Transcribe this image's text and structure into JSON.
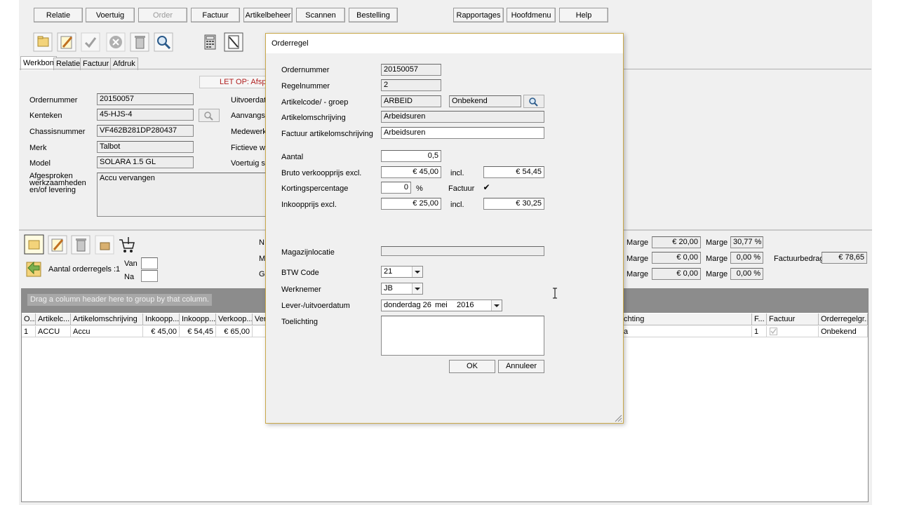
{
  "menu": {
    "relatie": "Relatie",
    "voertuig": "Voertuig",
    "order": "Order",
    "factuur": "Factuur",
    "artikelbeheer": "Artikelbeheer",
    "scannen": "Scannen",
    "bestelling": "Bestelling",
    "rapportages": "Rapportages",
    "hoofdmenu": "Hoofdmenu",
    "help": "Help"
  },
  "tabs": {
    "werkbon": "Werkbon",
    "relatie": "Relatie",
    "factuur": "Factuur",
    "afdruk": "Afdruk"
  },
  "notice": "LET OP: Afspra",
  "werkbon": {
    "ordernummer_label": "Ordernummer",
    "ordernummer": "20150057",
    "kenteken_label": "Kenteken",
    "kenteken": "45-HJS-4",
    "chassis_label": "Chassisnummer",
    "chassis": "VF462B281DP280437",
    "merk_label": "Merk",
    "merk": "Talbot",
    "model_label": "Model",
    "model": "SOLARA 1.5 GL",
    "afgesproken_label": "Afgesproken werkzaamheden en/of levering",
    "afgesproken": "Accu vervangen",
    "uitvoerdatum_label": "Uitvoerdatu",
    "aanvangstijd_label": "Aanvangstij",
    "medewerker_label": "Medewerke",
    "fictieve_label": "Fictieve we",
    "voertuig_label": "Voertuig sp"
  },
  "lower": {
    "aantal_orderregels": "Aantal orderregels :1",
    "van_label": "Van",
    "na_label": "Na",
    "n_label": "N",
    "m_label": "M",
    "g_label": "G",
    "marge_label": "Marge",
    "rows": [
      {
        "marge_eur": "€ 20,00",
        "marge_pct": "30,77 %"
      },
      {
        "marge_eur": "€ 0,00",
        "marge_pct": "0,00 %"
      },
      {
        "marge_eur": "€ 0,00",
        "marge_pct": "0,00 %"
      }
    ],
    "factuurbedrag_label": "Factuurbedrag",
    "factuurbedrag": "€ 78,65"
  },
  "grid": {
    "group_hint": "Drag a column header here to group by that column.",
    "columns": [
      "O...",
      "Artikelc...",
      "Artikelomschrijving",
      "Inkoopp...",
      "Inkoopp...",
      "Verkoop...",
      "Ver",
      "chting",
      "F...",
      "Factuur",
      "Orderregelgr..."
    ],
    "row": [
      "1",
      "ACCU",
      "Accu",
      "€ 45,00",
      "€ 54,45",
      "€ 65,00",
      "",
      "a",
      "1",
      "",
      "Onbekend"
    ]
  },
  "dialog": {
    "title": "Orderregel",
    "ordernummer_label": "Ordernummer",
    "ordernummer": "20150057",
    "regelnummer_label": "Regelnummer",
    "regelnummer": "2",
    "artikelcode_label": "Artikelcode/ - groep",
    "artikelcode": "ARBEID",
    "groep": "Onbekend",
    "artikelomschrijving_label": "Artikelomschrijving",
    "artikelomschrijving": "Arbeidsuren",
    "factuur_omschr_label": "Factuur artikelomschrijving",
    "factuur_omschr": "Arbeidsuren",
    "aantal_label": "Aantal",
    "aantal": "0,5",
    "bruto_label": "Bruto verkoopprijs excl.",
    "bruto_excl": "€ 45,00",
    "incl_label": "incl.",
    "bruto_incl": "€ 54,45",
    "korting_label": "Kortingspercentage",
    "korting": "0",
    "pct": "%",
    "factuur_label": "Factuur",
    "factuur_check": "✔",
    "inkoop_label": "Inkoopprijs excl.",
    "inkoop_excl": "€ 25,00",
    "inkoop_incl": "€ 30,25",
    "magazijn_label": "Magazijnlocatie",
    "magazijn": "",
    "btw_label": "BTW Code",
    "btw": "21",
    "werknemer_label": "Werknemer",
    "werknemer": "JB",
    "datum_label": "Lever-/uitvoerdatum",
    "datum_day": "donderdag 26",
    "datum_month": "mei",
    "datum_year": "2016",
    "toelichting_label": "Toelichting",
    "ok": "OK",
    "annuleer": "Annuleer"
  },
  "icons": [
    "new-icon",
    "edit-icon",
    "check-icon",
    "cancel-icon",
    "delete-icon",
    "search-icon",
    "calculator-icon",
    "note-icon",
    "cart-icon"
  ]
}
